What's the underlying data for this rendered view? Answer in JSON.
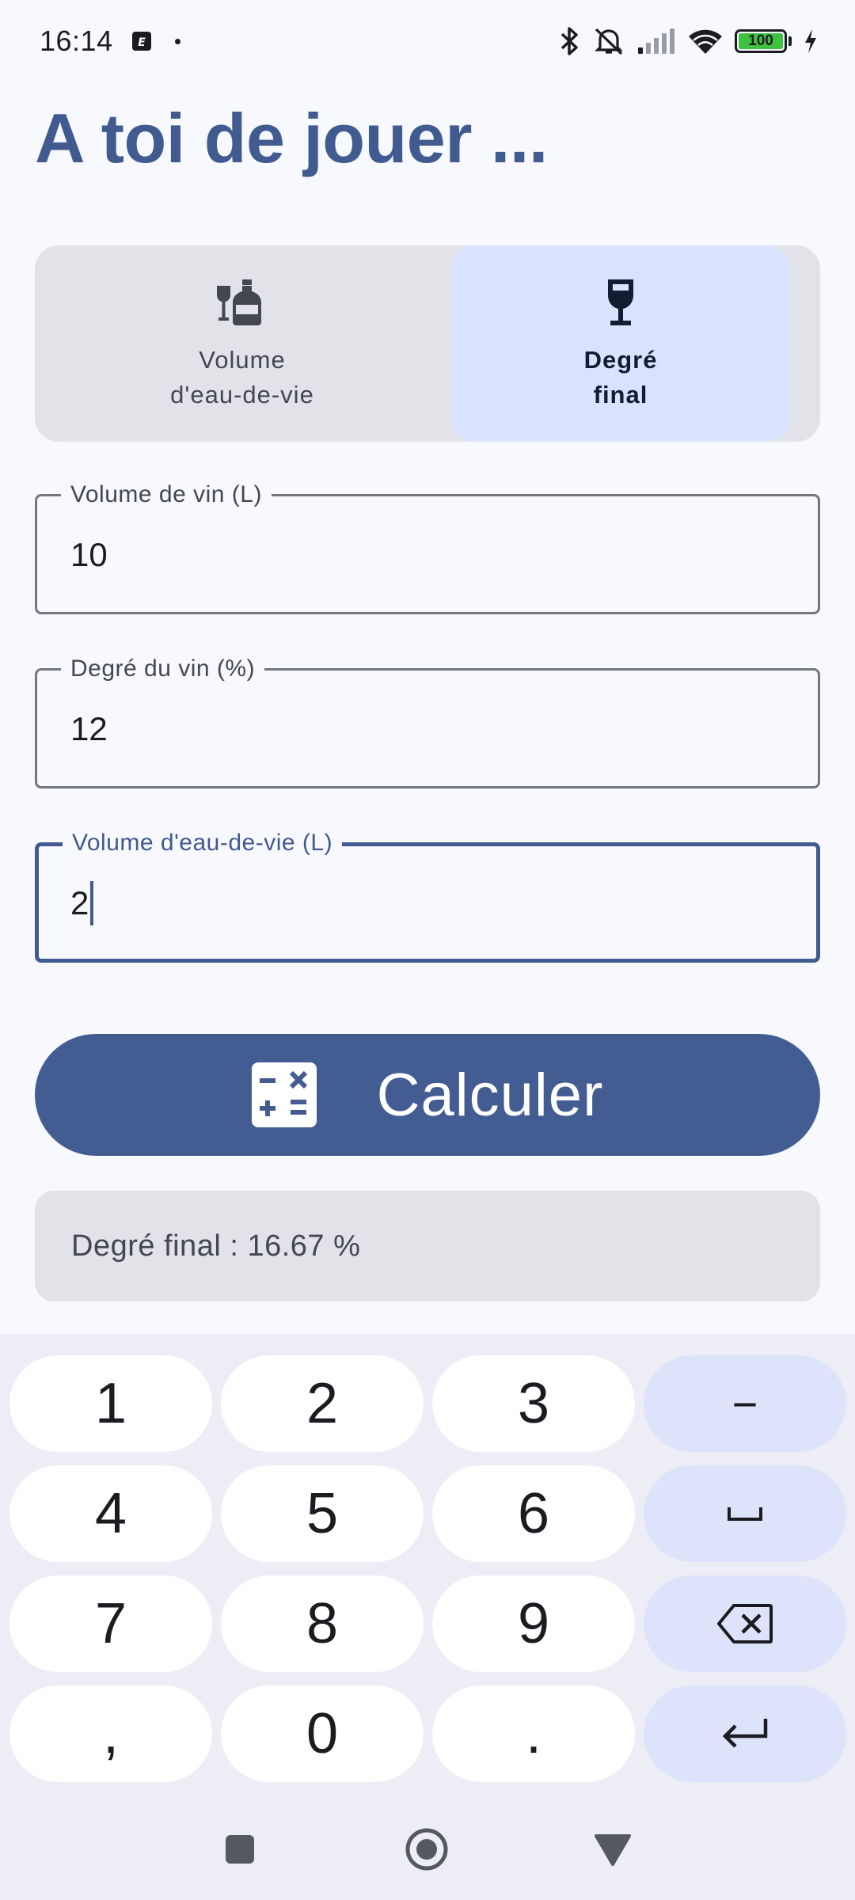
{
  "status_bar": {
    "time": "16:14",
    "notification_icon": "app-notification-icon",
    "battery": "100",
    "icons": [
      "bluetooth-icon",
      "silent-mode-icon",
      "cell-signal-icon",
      "wifi-icon",
      "battery-icon",
      "charging-icon"
    ]
  },
  "page": {
    "title": "A toi de jouer ..."
  },
  "tabs": [
    {
      "label": "Volume\nd'eau-de-vie",
      "icon": "bottle-and-glass-icon",
      "selected": false
    },
    {
      "label": "Degré\nfinal",
      "icon": "wine-glass-icon",
      "selected": true
    }
  ],
  "fields": {
    "wine_volume": {
      "label": "Volume de vin (L)",
      "value": "10"
    },
    "wine_degree": {
      "label": "Degré du vin (%)",
      "value": "12"
    },
    "spirit_volume": {
      "label": "Volume d'eau-de-vie (L)",
      "value": "2"
    }
  },
  "calculate_button": {
    "label": "Calculer",
    "icon": "calculator-icon",
    "color": "#435d92"
  },
  "result": {
    "text": "Degré final : 16.67 %"
  },
  "keyboard": {
    "rows": [
      [
        "1",
        "2",
        "3",
        "−"
      ],
      [
        "4",
        "5",
        "6",
        "space"
      ],
      [
        "7",
        "8",
        "9",
        "backspace"
      ],
      [
        ",",
        "0",
        ".",
        "enter"
      ]
    ]
  },
  "navigation_bar": {
    "buttons": [
      "recents-button",
      "home-button",
      "back-button"
    ]
  },
  "colors": {
    "primary": "#415a8f",
    "background": "#f8f9ff",
    "surface_variant": "#e2e2e9",
    "secondary_container": "#d9e2ff",
    "keyboard_bg": "#ecedf5"
  }
}
